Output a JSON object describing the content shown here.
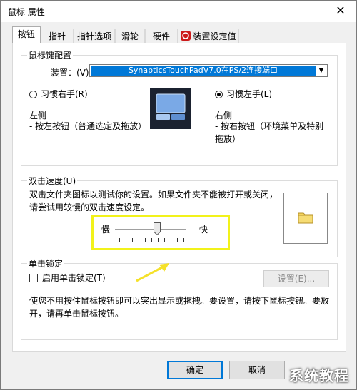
{
  "window": {
    "title": "鼠标 属性",
    "close_glyph": "✕"
  },
  "tabs": [
    {
      "label": "按钮",
      "active": true
    },
    {
      "label": "指针"
    },
    {
      "label": "指针选项"
    },
    {
      "label": "滑轮"
    },
    {
      "label": "硬件"
    },
    {
      "label": "装置设定值"
    }
  ],
  "button_config": {
    "group_label": "鼠标键配置",
    "device_label": "装置：(V)",
    "device_value": "SynapticsTouchPadV7.0在PS/2连接端口",
    "right_hand_label": "习惯右手(R)",
    "left_hand_label": "习惯左手(L)",
    "selected": "left",
    "left_title": "左侧",
    "left_desc": "- 按左按钮（普通选定及拖放）",
    "right_title": "右侧",
    "right_desc": "- 按右按钮（环境菜单及特别拖放）"
  },
  "double_click": {
    "group_label": "双击速度(U)",
    "description": "双击文件夹图标以测试你的设置。如果文件夹不能被打开或关闭，请尝试用较慢的双击速度设定。",
    "slow_label": "慢",
    "fast_label": "快",
    "speed_value": 0.55
  },
  "click_lock": {
    "group_label": "单击锁定",
    "checkbox_label": "启用单击锁定(T)",
    "checked": false,
    "settings_button": "设置(E)...",
    "description": "使您不用按住鼠标按钮即可以突出显示或拖拽。要设置，请按下鼠标按钮。要放开，请再单击鼠标按钮。"
  },
  "footer": {
    "ok": "确定",
    "cancel": "取消"
  },
  "watermark": "系统教程",
  "colors": {
    "accent": "#0078d7",
    "highlight_box": "#f2f21a",
    "annotation_arrow": "#f5e12a",
    "folder": "#f3d35c"
  }
}
